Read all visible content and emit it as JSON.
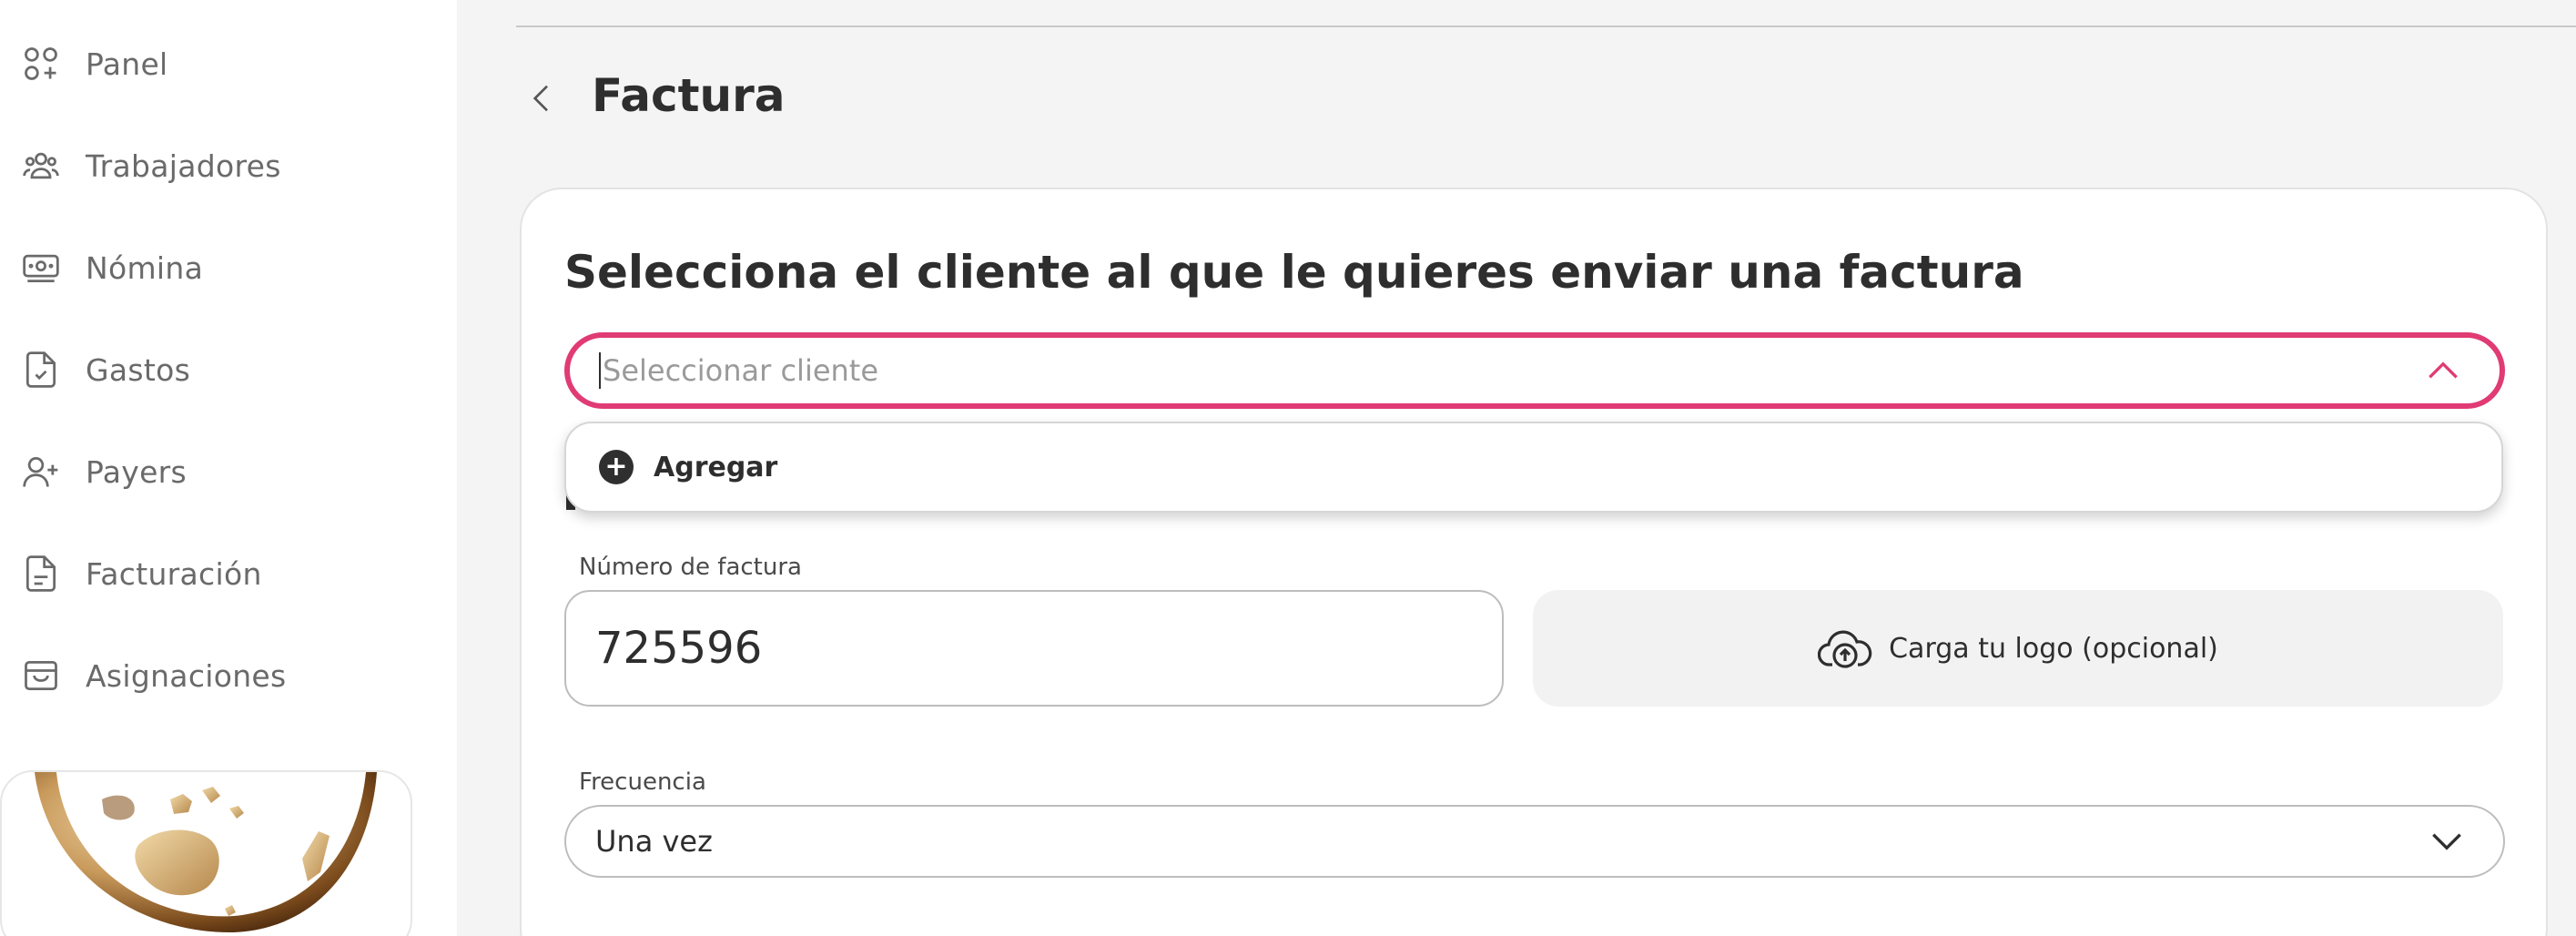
{
  "sidebar": {
    "items": [
      {
        "label": "Panel",
        "icon": "grid-plus-icon"
      },
      {
        "label": "Trabajadores",
        "icon": "users-icon"
      },
      {
        "label": "Nómina",
        "icon": "money-icon"
      },
      {
        "label": "Gastos",
        "icon": "file-check-icon"
      },
      {
        "label": "Payers",
        "icon": "user-plus-icon"
      },
      {
        "label": "Facturación",
        "icon": "file-text-icon"
      },
      {
        "label": "Asignaciones",
        "icon": "archive-icon"
      }
    ]
  },
  "header": {
    "title": "Factura"
  },
  "form": {
    "heading": "Selecciona el cliente al que le quieres enviar una factura",
    "client_select": {
      "placeholder": "Seleccionar cliente",
      "dropdown_add_label": "Agregar"
    },
    "invoice_number": {
      "label": "Número de factura",
      "value": "725596"
    },
    "logo_upload": {
      "label": "Carga tu logo (opcional)"
    },
    "frequency": {
      "label": "Frecuencia",
      "value": "Una vez"
    }
  },
  "colors": {
    "accent": "#e03b74",
    "text": "#2e2e2e",
    "background": "#f4f4f4"
  }
}
